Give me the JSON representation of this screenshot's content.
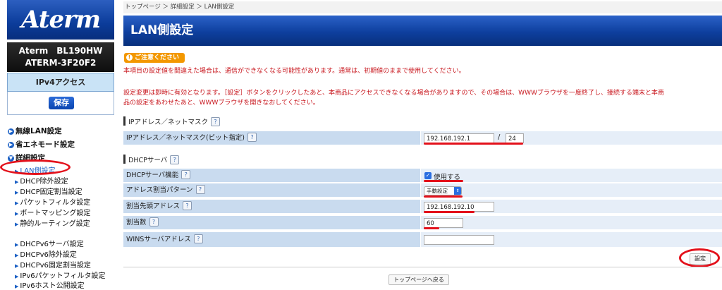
{
  "sidebar": {
    "logo": "Aterm",
    "model_line1": "Aterm　BL190HW",
    "model_line2": "ATERM-3F20F2",
    "mode": "IPv4アクセス",
    "save_label": "保存",
    "categories": [
      {
        "label": "無線LAN設定"
      },
      {
        "label": "省エネモード設定"
      },
      {
        "label": "詳細設定"
      }
    ],
    "items": [
      {
        "label": "LAN側設定"
      },
      {
        "label": "DHCP除外設定"
      },
      {
        "label": "DHCP固定割当設定"
      },
      {
        "label": "パケットフィルタ設定"
      },
      {
        "label": "ポートマッピング設定"
      },
      {
        "label": "静的ルーティング設定"
      },
      {
        "label": "DHCPv6サーバ設定"
      },
      {
        "label": "DHCPv6除外設定"
      },
      {
        "label": "DHCPv6固定割当設定"
      },
      {
        "label": "IPv6パケットフィルタ設定"
      },
      {
        "label": "IPv6ホスト公開設定"
      }
    ]
  },
  "breadcrumb": "トップページ ＞ 詳細設定 ＞ LAN側設定",
  "page_title": "LAN側設定",
  "caution_label": "ご注意ください",
  "warning1": "本項目の設定値を間違えた場合は、通信ができなくなる可能性があります。通常は、初期値のままで使用してください。",
  "warning2a": "設定変更は即時に有効となります。［設定］ボタンをクリックしたあと、本商品にアクセスできなくなる場合がありますので、その場合は、WWWブラウザを一度終了し、接続する端末と本商",
  "warning2b": "品の設定をあわせたあと、WWWブラウザを開きなおしてください。",
  "help_glyph": "?",
  "sections": {
    "ip": {
      "title": "IPアドレス／ネットマスク",
      "row_label": "IPアドレス／ネットマスク(ビット指定)",
      "ip_value": "192.168.192.1",
      "slash": "/",
      "mask_value": "24"
    },
    "dhcp": {
      "title": "DHCPサーバ",
      "server_label": "DHCPサーバ機能",
      "server_check": "使用する",
      "pattern_label": "アドレス割当パターン",
      "pattern_value": "手動設定",
      "start_label": "割当先頭アドレス",
      "start_value": "192.168.192.10",
      "count_label": "割当数",
      "count_value": "60",
      "wins_label": "WINSサーバアドレス",
      "wins_value": ""
    }
  },
  "apply_label": "設定",
  "top_page_label": "トップページへ戻る",
  "colors": {
    "header_blue": "#0e3f9e",
    "warning_red": "#c8161d",
    "annotation_red": "#e3111b",
    "caution_orange": "#f39800"
  }
}
